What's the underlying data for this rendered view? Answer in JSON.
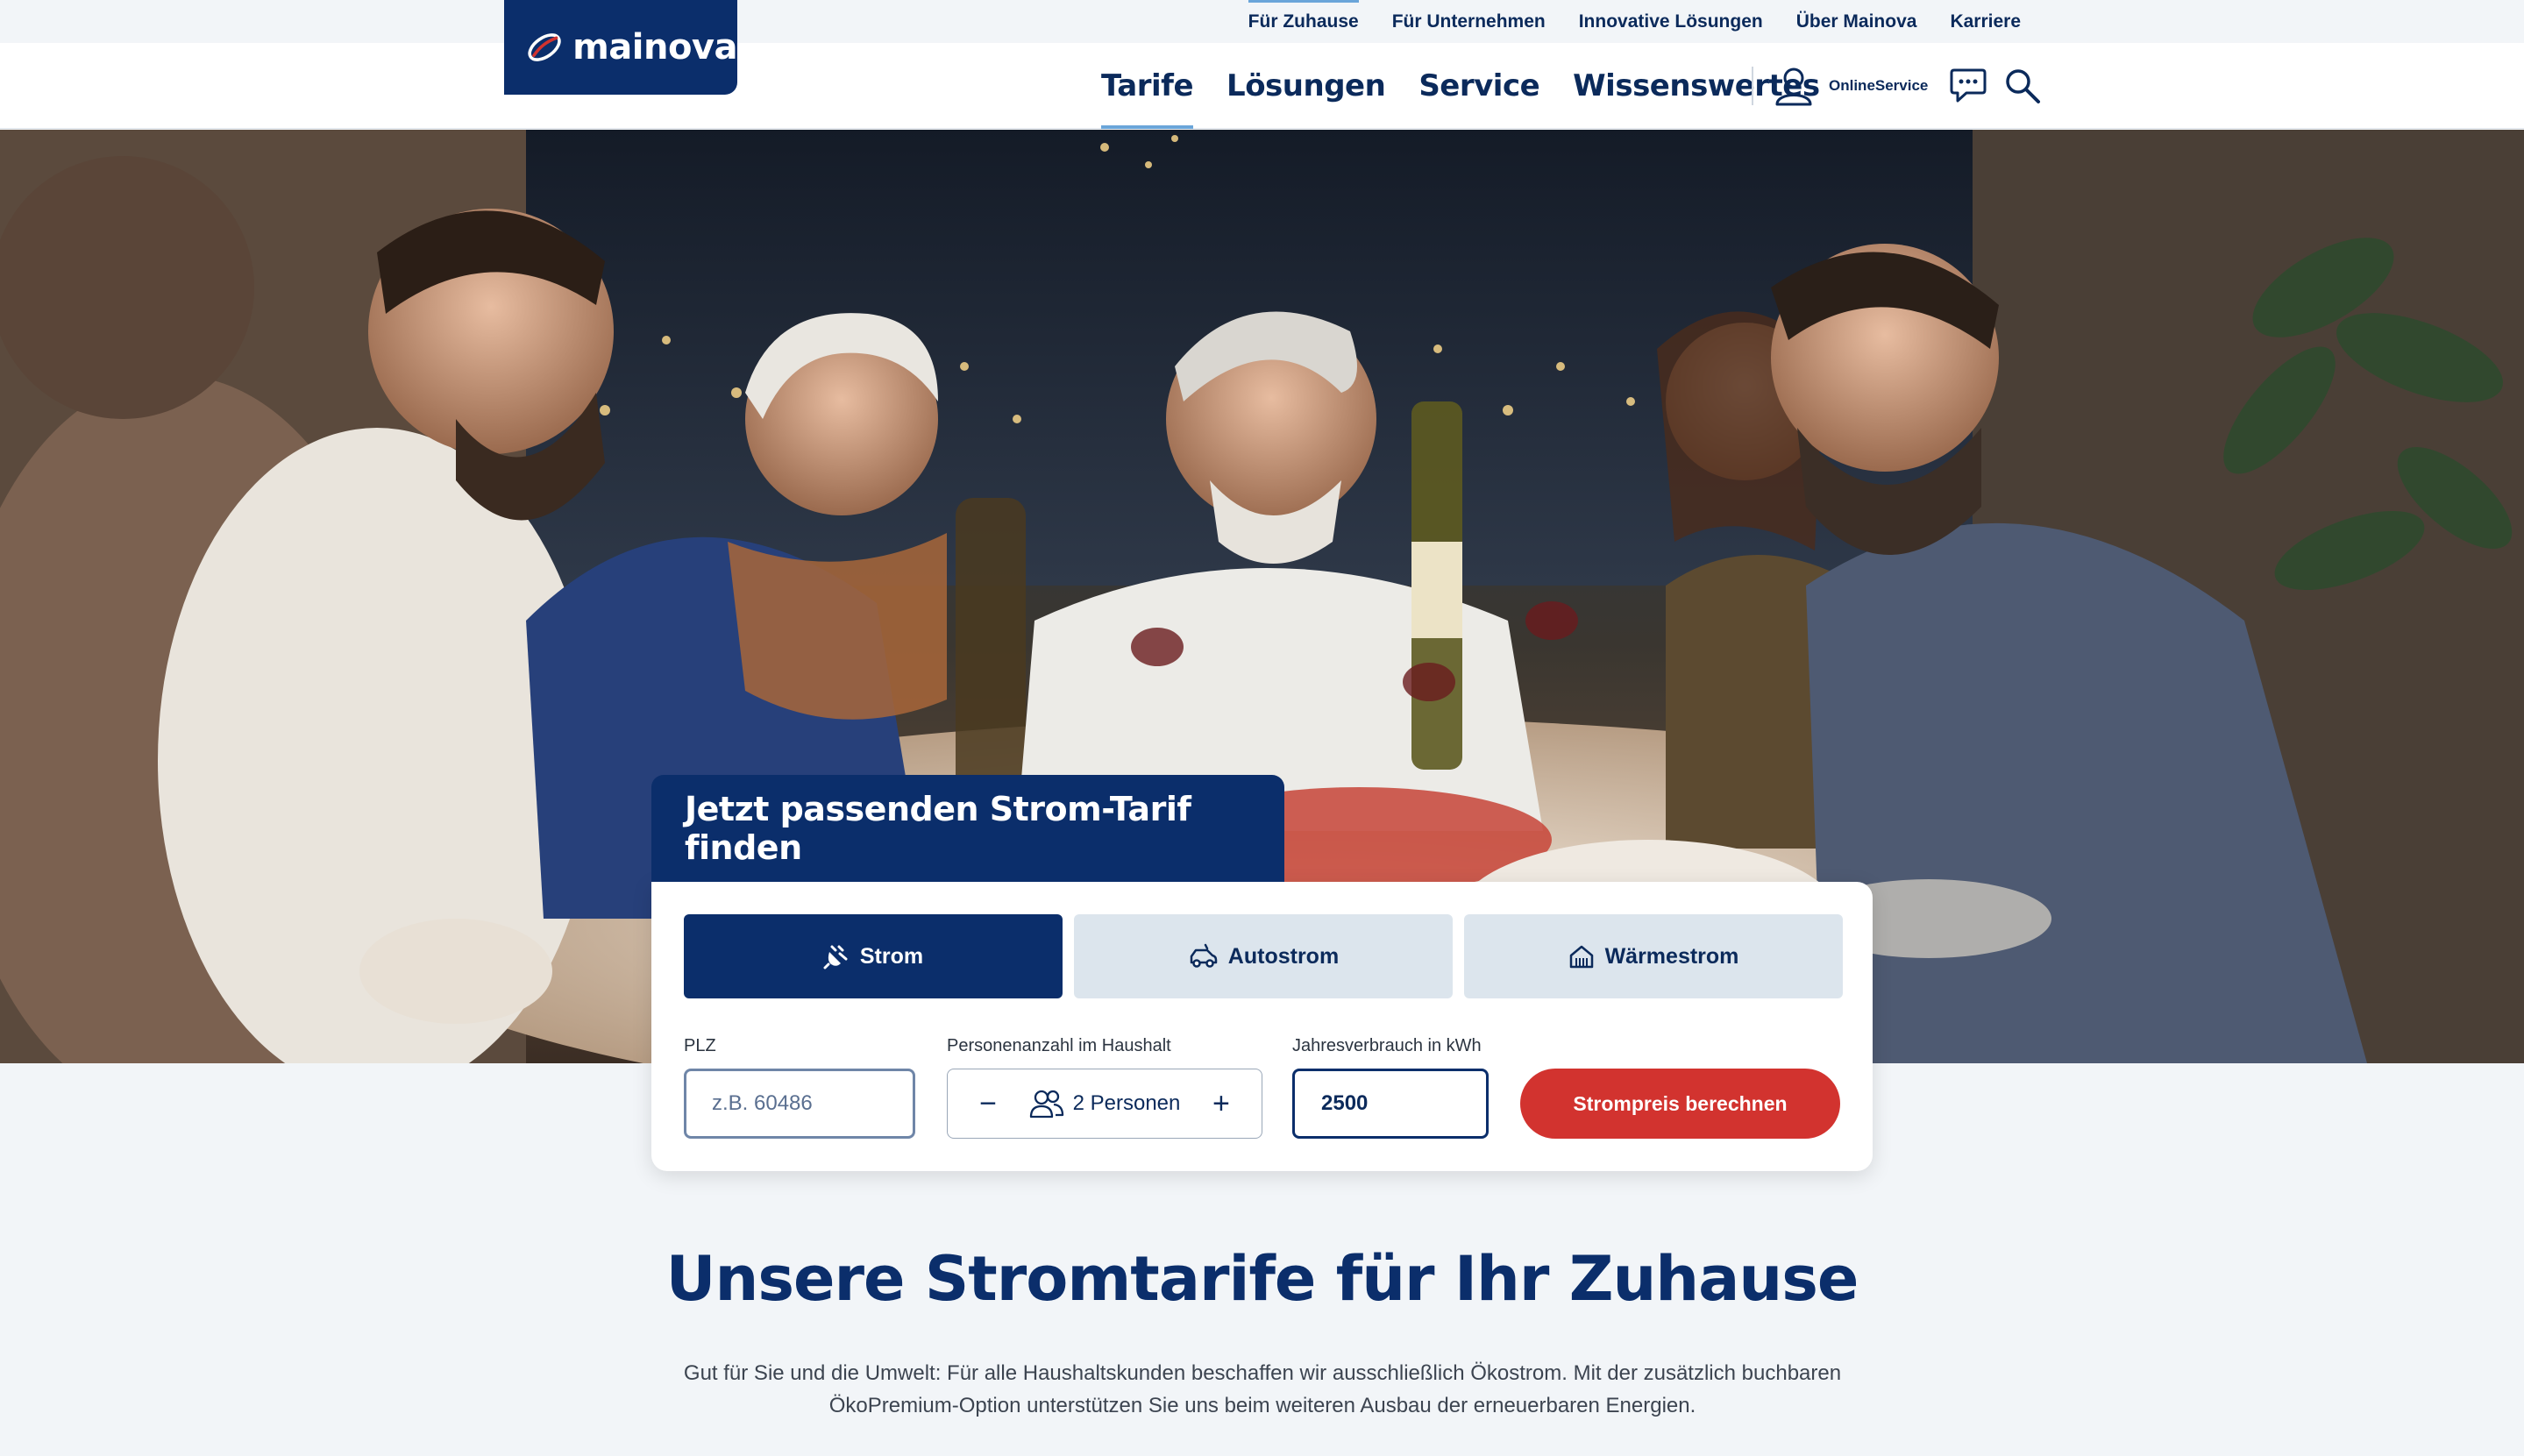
{
  "topbar": {
    "links": [
      {
        "label": "Für Zuhause",
        "active": true
      },
      {
        "label": "Für Unternehmen",
        "active": false
      },
      {
        "label": "Innovative Lösungen",
        "active": false
      },
      {
        "label": "Über Mainova",
        "active": false
      },
      {
        "label": "Karriere",
        "active": false
      }
    ]
  },
  "header": {
    "logo_text": "mainova",
    "nav": [
      {
        "label": "Tarife",
        "active": true
      },
      {
        "label": "Lösungen",
        "active": false
      },
      {
        "label": "Service",
        "active": false
      },
      {
        "label": "Wissenswertes",
        "active": false
      }
    ],
    "online_service_label": "OnlineService",
    "icons": [
      "user-icon",
      "chat-icon",
      "search-icon"
    ]
  },
  "finder": {
    "title": "Jetzt passenden Strom-Tarif finden",
    "tabs": [
      {
        "label": "Strom",
        "icon": "plug-icon",
        "active": true
      },
      {
        "label": "Autostrom",
        "icon": "car-icon",
        "active": false
      },
      {
        "label": "Wärmestrom",
        "icon": "house-heat-icon",
        "active": false
      }
    ],
    "plz": {
      "label": "PLZ",
      "placeholder": "z.B. 60486",
      "value": ""
    },
    "persons": {
      "label": "Personenanzahl im Haushalt",
      "value": "2 Personen",
      "minus": "−",
      "plus": "+"
    },
    "kwh": {
      "label": "Jahresverbrauch in kWh",
      "value": "2500"
    },
    "submit_label": "Strompreis berechnen"
  },
  "section": {
    "title": "Unsere Stromtarife für Ihr Zuhause",
    "text": "Gut für Sie und die Umwelt: Für alle Haushaltskunden beschaffen wir ausschließlich Ökostrom. Mit der zusätzlich buchbaren ÖkoPremium-Option unterstützen Sie uns beim weiteren Ausbau der erneuerbaren Energien."
  },
  "colors": {
    "brand_navy": "#0b2e6b",
    "accent_red": "#d2332f",
    "accent_light_blue": "#6aa5d9",
    "tab_inactive": "#dce5ed",
    "page_bg": "#f2f5f8"
  }
}
